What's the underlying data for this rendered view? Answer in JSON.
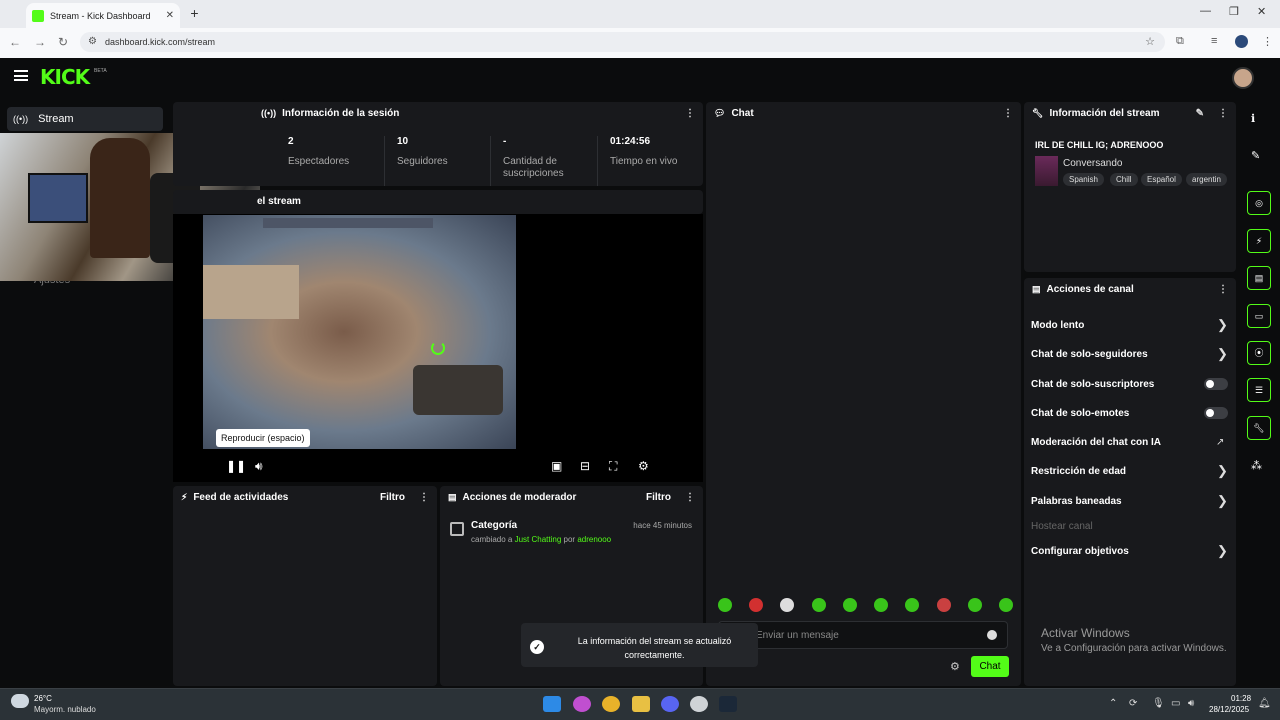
{
  "browser": {
    "tab_title": "Stream - Kick Dashboard",
    "url": "dashboard.kick.com/stream"
  },
  "kick": {
    "logo": "KICK",
    "beta": "BETA"
  },
  "sidebar": {
    "stream_label": "Stream",
    "settings_label": "Ajustes"
  },
  "session": {
    "title": "Información de la sesión",
    "stats": [
      {
        "value": "2",
        "label": "Espectadores"
      },
      {
        "value": "10",
        "label": "Seguidores"
      },
      {
        "value": "-",
        "label": "Cantidad de suscripciones"
      },
      {
        "value": "01:24:56",
        "label": "Tiempo en vivo"
      }
    ]
  },
  "preview": {
    "title": "el stream",
    "tooltip": "Reproducir (espacio)"
  },
  "feed": {
    "title": "Feed de actividades",
    "filter": "Filtro"
  },
  "mod": {
    "title": "Acciones de moderador",
    "filter": "Filtro",
    "item_title": "Categoría",
    "item_time": "hace 45 minutos",
    "item_pre": "cambiado a ",
    "item_cat": "Just Chatting",
    "item_mid": " por ",
    "item_user": "adrenooo"
  },
  "toast": {
    "message": "La información del stream se actualizó correctamente."
  },
  "chat": {
    "title": "Chat",
    "placeholder": "Enviar un mensaje",
    "send": "Chat"
  },
  "stream_info": {
    "title": "Información del stream",
    "stream_title": "IRL DE CHILL IG; ADRENOOO",
    "category": "Conversando",
    "tags": [
      "Spanish",
      "Chill",
      "Español",
      "argentin"
    ]
  },
  "actions": {
    "title": "Acciones de canal",
    "items": [
      {
        "label": "Modo lento",
        "kind": "chevron"
      },
      {
        "label": "Chat de solo-seguidores",
        "kind": "chevron"
      },
      {
        "label": "Chat de solo-suscriptores",
        "kind": "toggle"
      },
      {
        "label": "Chat de solo-emotes",
        "kind": "toggle"
      },
      {
        "label": "Moderación del chat con IA",
        "kind": "external"
      },
      {
        "label": "Restricción de edad",
        "kind": "chevron"
      },
      {
        "label": "Palabras baneadas",
        "kind": "chevron"
      },
      {
        "label": "Hostear canal",
        "kind": "disabled"
      },
      {
        "label": "Configurar objetivos",
        "kind": "chevron"
      }
    ]
  },
  "windows_activation": {
    "title": "Activar Windows",
    "subtitle": "Ve a Configuración para activar Windows."
  },
  "taskbar": {
    "temperature": "26°C",
    "weather": "Mayorm. nublado",
    "time": "01:28",
    "date": "28/12/2025"
  },
  "colors": {
    "accent": "#53fc18",
    "panel": "#18191c",
    "background": "#0b0c0d"
  }
}
